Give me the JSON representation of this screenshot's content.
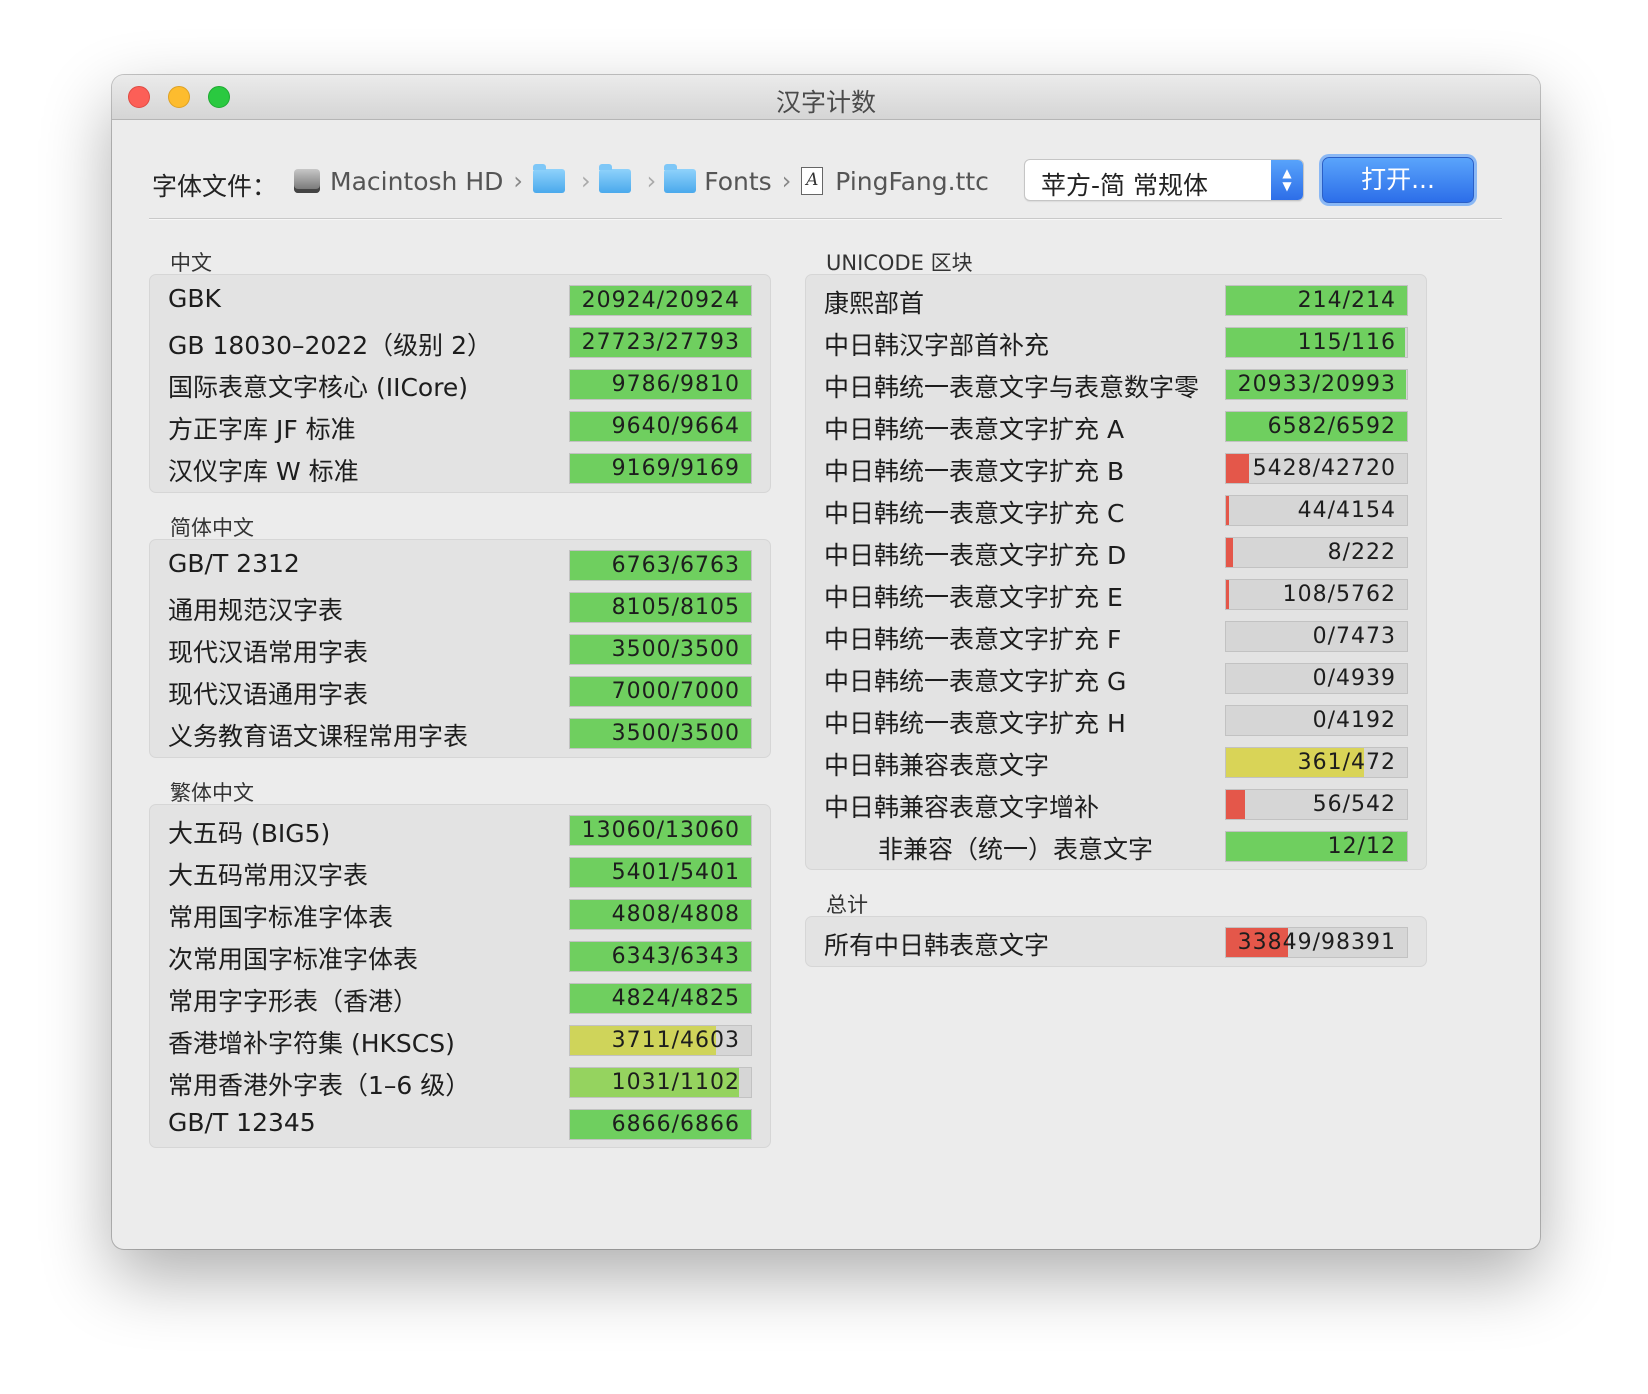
{
  "window": {
    "title": "汉字计数"
  },
  "toolbar": {
    "font_file_label": "字体文件：",
    "path": [
      {
        "icon": "hard-drive-icon",
        "label": "Macintosh HD"
      },
      {
        "icon": "folder-icon",
        "label": ""
      },
      {
        "icon": "folder-icon",
        "label": ""
      },
      {
        "icon": "folder-icon",
        "label": "Fonts"
      },
      {
        "icon": "font-file-icon",
        "label": "PingFang.ttc"
      }
    ],
    "font_face": "苹方-简 常规体",
    "open_button": "打开..."
  },
  "colors": {
    "green": "#6fcf5f",
    "yellow": "#d9d457",
    "yellow_green": "#b9d35f",
    "light_green": "#95d35f",
    "red": "#e4574a",
    "track": "#d6d6d6",
    "accent_blue": "#2f72ea"
  },
  "sections": {
    "chinese": {
      "title": "中文",
      "rows": [
        {
          "label": "GBK",
          "count": "20924",
          "total": "20924",
          "fraction": 1.0,
          "color": "#6fcf5f"
        },
        {
          "label": "GB 18030–2022（级别 2）",
          "count": "27723",
          "total": "27793",
          "fraction": 0.9975,
          "color": "#6fcf5f"
        },
        {
          "label": "国际表意文字核心 (IICore)",
          "count": "9786",
          "total": "9810",
          "fraction": 0.9976,
          "color": "#6fcf5f"
        },
        {
          "label": "方正字库 JF 标准",
          "count": "9640",
          "total": "9664",
          "fraction": 0.9975,
          "color": "#6fcf5f"
        },
        {
          "label": "汉仪字库 W 标准",
          "count": "9169",
          "total": "9169",
          "fraction": 1.0,
          "color": "#6fcf5f"
        }
      ]
    },
    "simplified": {
      "title": "简体中文",
      "rows": [
        {
          "label": "GB/T 2312",
          "count": "6763",
          "total": "6763",
          "fraction": 1.0,
          "color": "#6fcf5f"
        },
        {
          "label": "通用规范汉字表",
          "count": "8105",
          "total": "8105",
          "fraction": 1.0,
          "color": "#6fcf5f"
        },
        {
          "label": "现代汉语常用字表",
          "count": "3500",
          "total": "3500",
          "fraction": 1.0,
          "color": "#6fcf5f"
        },
        {
          "label": "现代汉语通用字表",
          "count": "7000",
          "total": "7000",
          "fraction": 1.0,
          "color": "#6fcf5f"
        },
        {
          "label": "义务教育语文课程常用字表",
          "count": "3500",
          "total": "3500",
          "fraction": 1.0,
          "color": "#6fcf5f"
        }
      ]
    },
    "traditional": {
      "title": "繁体中文",
      "rows": [
        {
          "label": "大五码 (BIG5)",
          "count": "13060",
          "total": "13060",
          "fraction": 1.0,
          "color": "#6fcf5f"
        },
        {
          "label": "大五码常用汉字表",
          "count": "5401",
          "total": "5401",
          "fraction": 1.0,
          "color": "#6fcf5f"
        },
        {
          "label": "常用国字标准字体表",
          "count": "4808",
          "total": "4808",
          "fraction": 1.0,
          "color": "#6fcf5f"
        },
        {
          "label": "次常用国字标准字体表",
          "count": "6343",
          "total": "6343",
          "fraction": 1.0,
          "color": "#6fcf5f"
        },
        {
          "label": "常用字字形表（香港）",
          "count": "4824",
          "total": "4825",
          "fraction": 0.9998,
          "color": "#6fcf5f"
        },
        {
          "label": "香港增补字符集 (HKSCS)",
          "count": "3711",
          "total": "4603",
          "fraction": 0.806,
          "color": "#cfd45a"
        },
        {
          "label": "常用香港外字表（1–6 级）",
          "count": "1031",
          "total": "1102",
          "fraction": 0.936,
          "color": "#95d35f"
        },
        {
          "label": "GB/T 12345",
          "count": "6866",
          "total": "6866",
          "fraction": 1.0,
          "color": "#6fcf5f"
        }
      ]
    },
    "unicode": {
      "title": "UNICODE 区块",
      "rows": [
        {
          "label": "康熙部首",
          "count": "214",
          "total": "214",
          "fraction": 1.0,
          "color": "#6fcf5f"
        },
        {
          "label": "中日韩汉字部首补充",
          "count": "115",
          "total": "116",
          "fraction": 0.991,
          "color": "#6fcf5f"
        },
        {
          "label": "中日韩统一表意文字与表意数字零",
          "count": "20933",
          "total": "20993",
          "fraction": 0.997,
          "color": "#6fcf5f"
        },
        {
          "label": "中日韩统一表意文字扩充 A",
          "count": "6582",
          "total": "6592",
          "fraction": 0.998,
          "color": "#6fcf5f"
        },
        {
          "label": "中日韩统一表意文字扩充 B",
          "count": "5428",
          "total": "42720",
          "fraction": 0.127,
          "color": "#e4574a"
        },
        {
          "label": "中日韩统一表意文字扩充 C",
          "count": "44",
          "total": "4154",
          "fraction": 0.0106,
          "color": "#e4574a"
        },
        {
          "label": "中日韩统一表意文字扩充 D",
          "count": "8",
          "total": "222",
          "fraction": 0.036,
          "color": "#e4574a"
        },
        {
          "label": "中日韩统一表意文字扩充 E",
          "count": "108",
          "total": "5762",
          "fraction": 0.0187,
          "color": "#e4574a"
        },
        {
          "label": "中日韩统一表意文字扩充 F",
          "count": "0",
          "total": "7473",
          "fraction": 0.0,
          "color": "#e4574a"
        },
        {
          "label": "中日韩统一表意文字扩充 G",
          "count": "0",
          "total": "4939",
          "fraction": 0.0,
          "color": "#e4574a"
        },
        {
          "label": "中日韩统一表意文字扩充 H",
          "count": "0",
          "total": "4192",
          "fraction": 0.0,
          "color": "#e4574a"
        },
        {
          "label": "中日韩兼容表意文字",
          "count": "361",
          "total": "472",
          "fraction": 0.765,
          "color": "#d9d457"
        },
        {
          "label": "中日韩兼容表意文字增补",
          "count": "56",
          "total": "542",
          "fraction": 0.103,
          "color": "#e4574a"
        },
        {
          "label": "非兼容（统一）表意文字",
          "count": "12",
          "total": "12",
          "fraction": 1.0,
          "color": "#6fcf5f",
          "indent": true
        }
      ]
    },
    "total": {
      "title": "总计",
      "rows": [
        {
          "label": "所有中日韩表意文字",
          "count": "33849",
          "total": "98391",
          "fraction": 0.344,
          "color": "#e4574a"
        }
      ]
    }
  }
}
